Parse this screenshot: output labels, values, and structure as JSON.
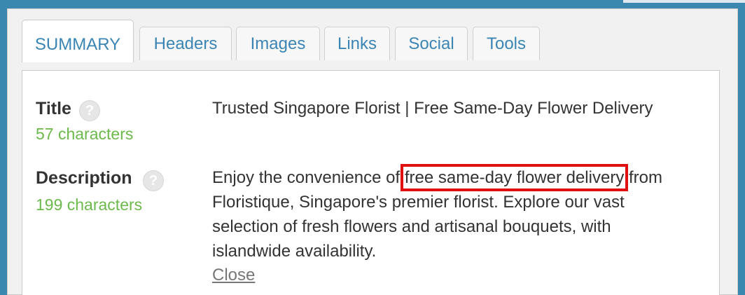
{
  "tabs": [
    {
      "label": "SUMMARY",
      "active": true
    },
    {
      "label": "Headers",
      "active": false
    },
    {
      "label": "Images",
      "active": false
    },
    {
      "label": "Links",
      "active": false
    },
    {
      "label": "Social",
      "active": false
    },
    {
      "label": "Tools",
      "active": false
    }
  ],
  "summary": {
    "title": {
      "label": "Title",
      "help_icon": "question-icon",
      "count": "57 characters",
      "value": "Trusted Singapore Florist | Free Same-Day Flower Delivery"
    },
    "description": {
      "label": "Description",
      "help_icon": "question-icon",
      "count": "199 characters",
      "value_before": "Enjoy the convenience of ",
      "value_highlight": "free same-day flower delivery",
      "value_after": " from Floristique, Singapore's premier florist. Explore our vast selection of fresh flowers and artisanal bouquets, with islandwide availability."
    },
    "close_label": "Close"
  },
  "colors": {
    "frame": "#3a87b0",
    "tab_text": "#3b85b4",
    "count_text": "#6cb94c",
    "highlight_border": "#e01010"
  }
}
